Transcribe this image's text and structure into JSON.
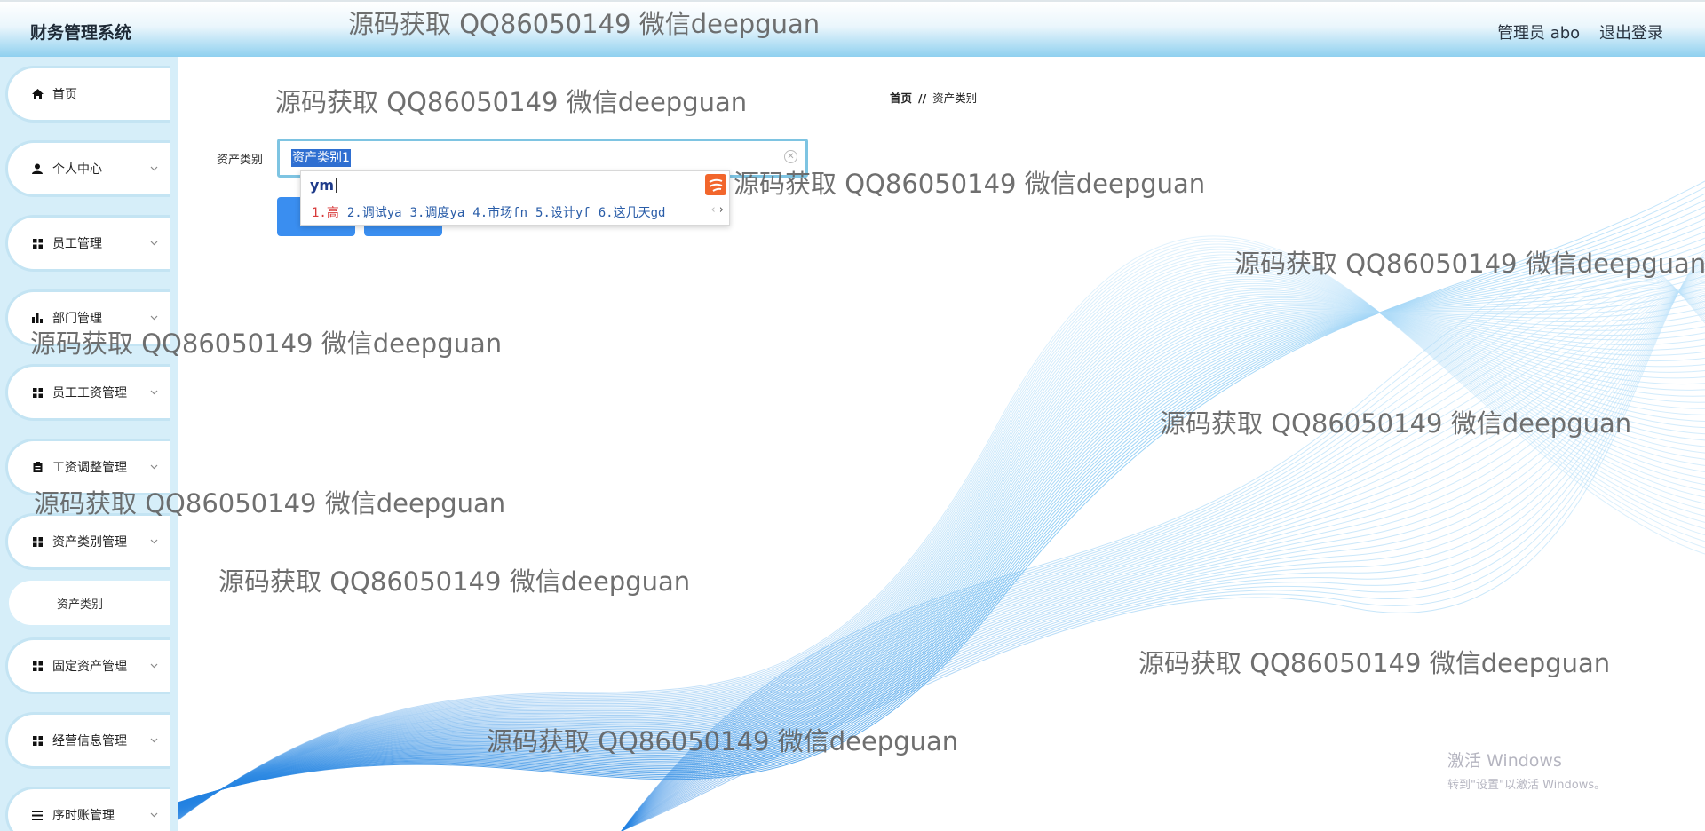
{
  "header": {
    "title": "财务管理系统",
    "user": "管理员 abo",
    "logout": "退出登录"
  },
  "sidebar": {
    "items": [
      {
        "label": "首页"
      },
      {
        "label": "个人中心"
      },
      {
        "label": "员工管理"
      },
      {
        "label": "部门管理"
      },
      {
        "label": "员工工资管理"
      },
      {
        "label": "工资调整管理"
      },
      {
        "label": "资产类别管理"
      },
      {
        "label": "固定资产管理"
      },
      {
        "label": "经营信息管理"
      },
      {
        "label": "序时账管理"
      }
    ],
    "active_sub": "资产类别"
  },
  "breadcrumb": {
    "home": "首页",
    "separator": "//",
    "current": "资产类别"
  },
  "form": {
    "label": "资产类别",
    "value": "资产类别1"
  },
  "ime": {
    "composition": "ym",
    "candidates": [
      "1.高",
      "2.调试ya",
      "3.调度ya",
      "4.市场fn",
      "5.设计yf",
      "6.这几天gd"
    ]
  },
  "watermark": "源码获取 QQ86050149 微信deepguan",
  "os": {
    "activate_title": "激活 Windows",
    "activate_sub": "转到\"设置\"以激活 Windows。"
  },
  "colors": {
    "primary_button": "#3a8ef0",
    "sidebar_bg": "#d6eef9",
    "selection": "#2f6fd1"
  }
}
